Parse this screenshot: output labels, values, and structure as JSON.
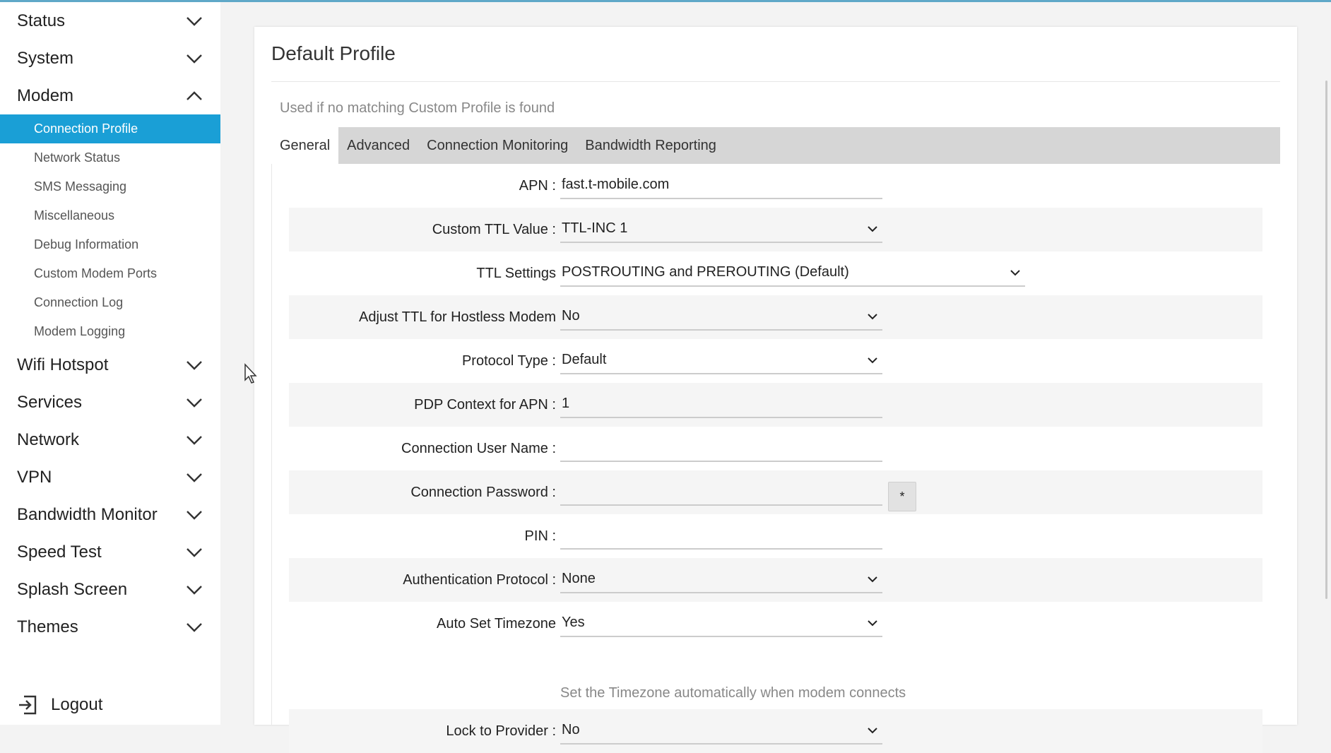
{
  "sidebar": {
    "menus_top": [
      {
        "label": "Status",
        "icon": "chevron-down-icon"
      },
      {
        "label": "System",
        "icon": "chevron-down-icon"
      },
      {
        "label": "Modem",
        "icon": "chevron-up-icon"
      }
    ],
    "modem_submenu": [
      {
        "label": "Connection Profile",
        "active": true
      },
      {
        "label": "Network Status"
      },
      {
        "label": "SMS Messaging"
      },
      {
        "label": "Miscellaneous"
      },
      {
        "label": "Debug Information"
      },
      {
        "label": "Custom Modem Ports"
      },
      {
        "label": "Connection Log"
      },
      {
        "label": "Modem Logging"
      }
    ],
    "menus_bottom": [
      {
        "label": "Wifi Hotspot"
      },
      {
        "label": "Services"
      },
      {
        "label": "Network"
      },
      {
        "label": "VPN"
      },
      {
        "label": "Bandwidth Monitor"
      },
      {
        "label": "Speed Test"
      },
      {
        "label": "Splash Screen"
      },
      {
        "label": "Themes"
      }
    ],
    "logout_label": "Logout"
  },
  "card": {
    "title": "Default Profile",
    "description": "Used if no matching Custom Profile is found"
  },
  "tabs": [
    "General",
    "Advanced",
    "Connection Monitoring",
    "Bandwidth Reporting"
  ],
  "form": {
    "apn": {
      "label": "APN :",
      "value": "fast.t-mobile.com"
    },
    "custom_ttl": {
      "label": "Custom TTL Value :",
      "value": "TTL-INC 1"
    },
    "ttl_settings": {
      "label": "TTL Settings",
      "value": "POSTROUTING and PREROUTING (Default)"
    },
    "adjust_ttl": {
      "label": "Adjust TTL for Hostless Modem",
      "value": "No"
    },
    "protocol_type": {
      "label": "Protocol Type :",
      "value": "Default"
    },
    "pdp_context": {
      "label": "PDP Context for APN :",
      "value": "1"
    },
    "user_name": {
      "label": "Connection User Name :",
      "value": ""
    },
    "password": {
      "label": "Connection Password :",
      "value": "",
      "toggle_label": "*"
    },
    "pin": {
      "label": "PIN :",
      "value": ""
    },
    "auth_protocol": {
      "label": "Authentication Protocol :",
      "value": "None"
    },
    "auto_timezone": {
      "label": "Auto Set Timezone",
      "value": "Yes",
      "hint": "Set the Timezone automatically when modem connects"
    },
    "lock_provider": {
      "label": "Lock to Provider :",
      "value": "No"
    }
  },
  "colors": {
    "accent": "#1a9fd6",
    "tabbar": "#d6d6d6",
    "row_shade": "#f5f5f5"
  }
}
